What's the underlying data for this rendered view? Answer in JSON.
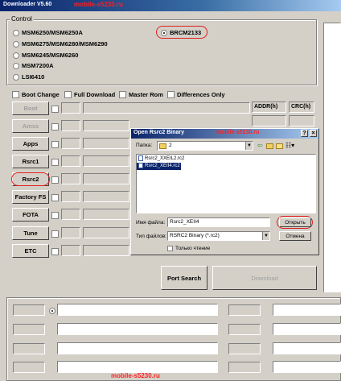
{
  "window": {
    "title": "Downloader V5.60",
    "watermark": "mobile-s5230.ru"
  },
  "control": {
    "title": "Control",
    "options": [
      {
        "label": "MSM6250/MSM6250A",
        "selected": false
      },
      {
        "label": "MSM6275/MSM6280/MSM6290",
        "selected": false
      },
      {
        "label": "MSM6245/MSM6260",
        "selected": false
      },
      {
        "label": "MSM7200A",
        "selected": false
      },
      {
        "label": "LSI6410",
        "selected": false
      },
      {
        "label": "BRCM2133",
        "selected": true
      }
    ]
  },
  "checks": {
    "boot_change": "Boot Change",
    "full_download": "Full Download",
    "master_rom": "Master Rom",
    "differences_only": "Differences Only"
  },
  "columns": {
    "addr": "ADDR(h)",
    "crc": "CRC(h)"
  },
  "file_buttons": [
    {
      "label": "Boot",
      "enabled": false
    },
    {
      "label": "Amss",
      "enabled": false
    },
    {
      "label": "Apps",
      "enabled": true
    },
    {
      "label": "Rsrc1",
      "enabled": true
    },
    {
      "label": "Rsrc2",
      "enabled": true
    },
    {
      "label": "Factory FS",
      "enabled": true
    },
    {
      "label": "FOTA",
      "enabled": true
    },
    {
      "label": "Tune",
      "enabled": true
    },
    {
      "label": "ETC",
      "enabled": true
    }
  ],
  "actions": {
    "port_search": "Port Search",
    "download": "Download"
  },
  "dialog": {
    "title": "Open Rsrc2 Binary",
    "watermark": "mobile-s5230.ru",
    "folder_label": "Папка:",
    "folder_value": "2",
    "files": [
      {
        "name": "Rsrc2_XXEIL2.rc2",
        "selected": false
      },
      {
        "name": "Rsrc2_XEII4.rc2",
        "selected": true
      }
    ],
    "filename_label": "Имя файла:",
    "filename_value": "Rsrc2_XEII4",
    "filetype_label": "Тип файлов:",
    "filetype_value": "RSRC2 Binary (*.rc2)",
    "readonly_label": "Только чтение",
    "open_button": "Открыть",
    "cancel_button": "Отмена",
    "help_button": "?",
    "close_button": "×"
  },
  "footer": {
    "watermark": "mobile-s5230.ru"
  }
}
